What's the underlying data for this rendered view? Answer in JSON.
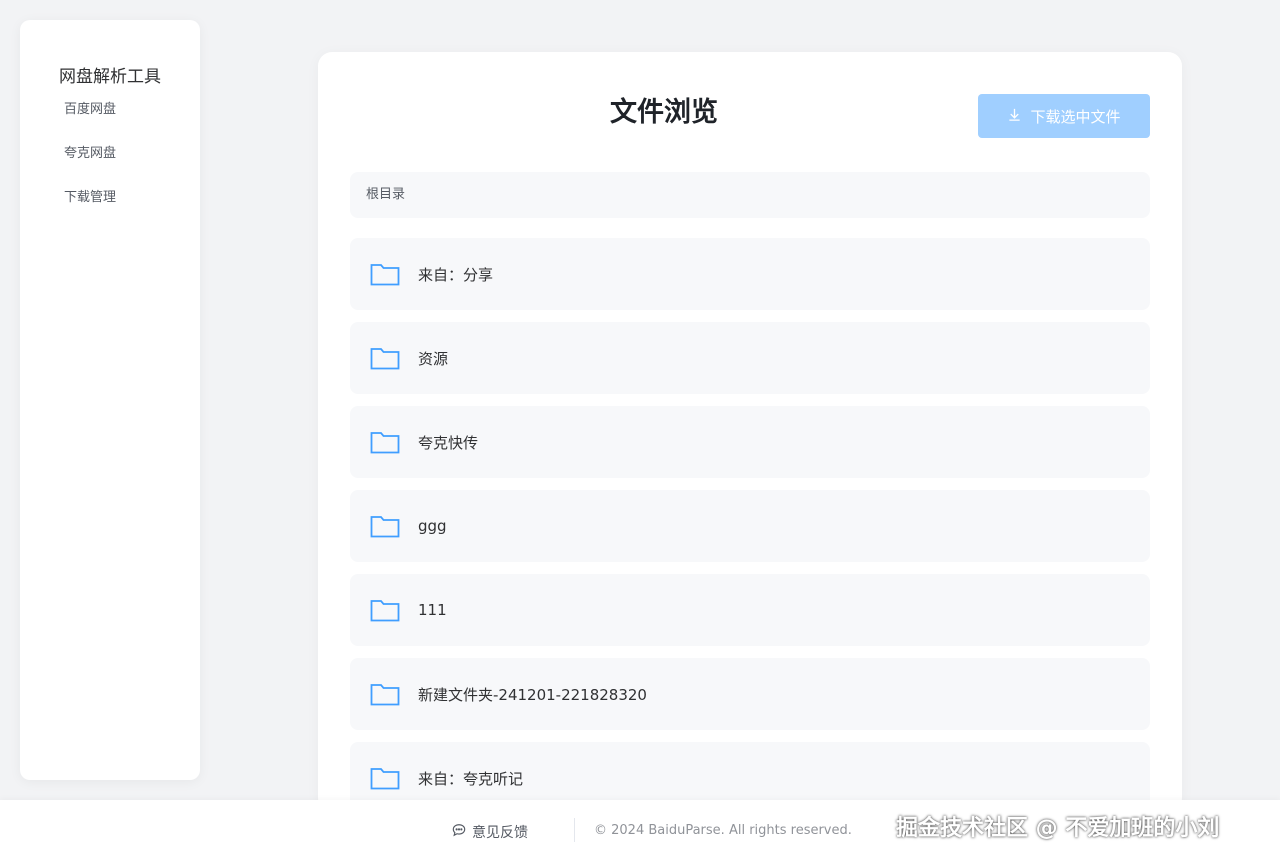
{
  "sidebar": {
    "title": "网盘解析工具",
    "items": [
      {
        "label": "百度网盘"
      },
      {
        "label": "夸克网盘"
      },
      {
        "label": "下载管理"
      }
    ]
  },
  "main": {
    "title": "文件浏览",
    "download_button": {
      "label": "下载选中文件",
      "icon": "download-icon",
      "disabled": true
    },
    "breadcrumb": "根目录",
    "files": [
      {
        "name": "来自：分享",
        "icon": "folder-icon"
      },
      {
        "name": "资源",
        "icon": "folder-icon"
      },
      {
        "name": "夸克快传",
        "icon": "folder-icon"
      },
      {
        "name": "ggg",
        "icon": "folder-icon"
      },
      {
        "name": "111",
        "icon": "folder-icon"
      },
      {
        "name": "新建文件夹-241201-221828320",
        "icon": "folder-icon"
      },
      {
        "name": "来自：夸克听记",
        "icon": "folder-icon"
      }
    ]
  },
  "footer": {
    "feedback": "意见反馈",
    "copyright": "© 2024 BaiduParse. All rights reserved.",
    "watermark": "掘金技术社区 @ 不爱加班的小刘"
  },
  "colors": {
    "accent": "#409eff",
    "button_disabled": "#a0cfff",
    "background": "#f2f3f5"
  }
}
